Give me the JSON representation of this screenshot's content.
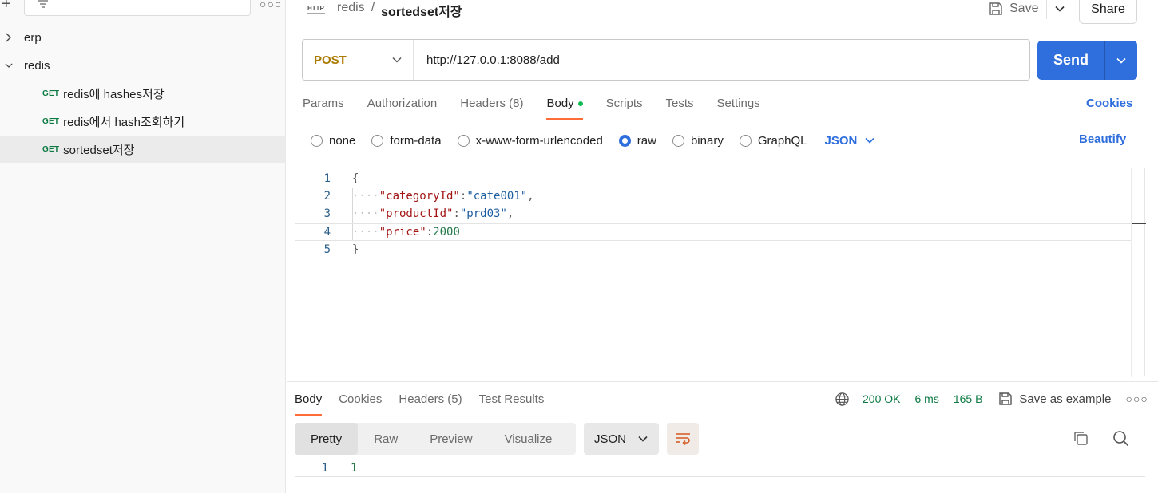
{
  "sidebar": {
    "tree": [
      {
        "label": "erp",
        "expanded": false
      },
      {
        "label": "redis",
        "expanded": true
      }
    ],
    "requests": [
      {
        "method": "GET",
        "label": "redis에 hashes저장"
      },
      {
        "method": "GET",
        "label": "redis에서 hash조회하기"
      },
      {
        "method": "GET",
        "label": "sortedset저장",
        "selected": true
      }
    ]
  },
  "header": {
    "breadcrumb_parent": "redis",
    "breadcrumb_sep": "/",
    "breadcrumb_current": "sortedset저장",
    "save_label": "Save",
    "share_label": "Share"
  },
  "request": {
    "method": "POST",
    "url": "http://127.0.0.1:8088/add",
    "send_label": "Send"
  },
  "req_tabs": {
    "params": "Params",
    "authorization": "Authorization",
    "headers": "Headers",
    "headers_count": "(8)",
    "body": "Body",
    "scripts": "Scripts",
    "tests": "Tests",
    "settings": "Settings",
    "cookies": "Cookies"
  },
  "body_types": {
    "none": "none",
    "form_data": "form-data",
    "urlencoded": "x-www-form-urlencoded",
    "raw": "raw",
    "binary": "binary",
    "graphql": "GraphQL",
    "language": "JSON",
    "beautify": "Beautify",
    "selected": "raw"
  },
  "editor": {
    "line_numbers": [
      "1",
      "2",
      "3",
      "4",
      "5"
    ],
    "open_brace": "{",
    "close_brace": "}",
    "guide": "····",
    "fields": [
      {
        "key": "\"categoryId\"",
        "value": "\"cate001\"",
        "comma": ","
      },
      {
        "key": "\"productId\"",
        "value": "\"prd03\"",
        "comma": ","
      },
      {
        "key": "\"price\"",
        "value": "2000",
        "comma": ""
      }
    ],
    "colon": ":"
  },
  "response": {
    "tabs": {
      "body": "Body",
      "cookies": "Cookies",
      "headers": "Headers",
      "headers_count": "(5)",
      "test_results": "Test Results"
    },
    "status": "200 OK",
    "time": "6 ms",
    "size": "165 B",
    "save_example": "Save as example",
    "views": {
      "pretty": "Pretty",
      "raw": "Raw",
      "preview": "Preview",
      "visualize": "Visualize"
    },
    "format": "JSON",
    "line_number": "1",
    "body": "1"
  },
  "colors": {
    "accent": "#ff6c37",
    "primary": "#2f6fdd",
    "get_method": "#0c7a43",
    "post_method": "#ab7a00"
  }
}
